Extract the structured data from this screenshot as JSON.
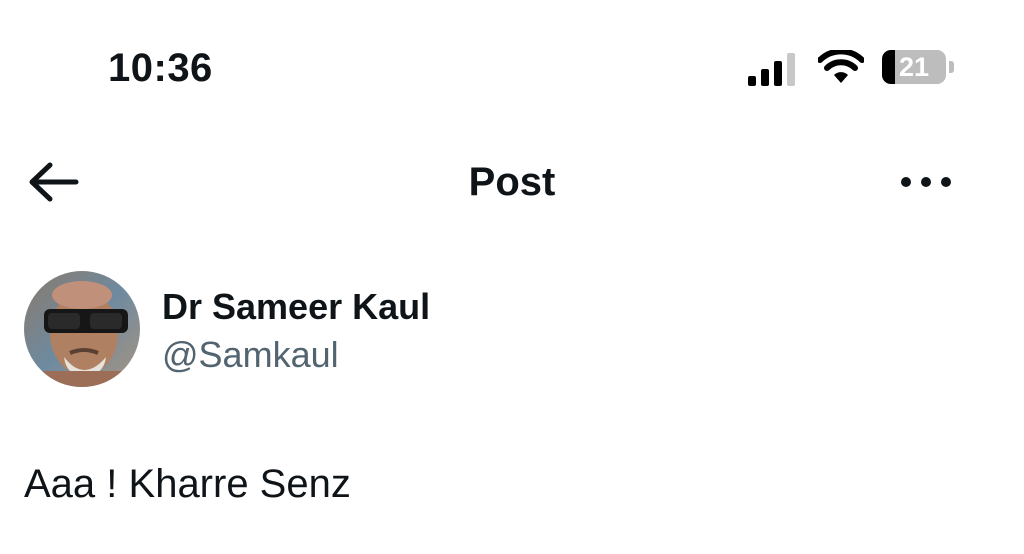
{
  "status_bar": {
    "time": "10:36",
    "battery_level": "21",
    "icons": [
      "cellular-signal-icon",
      "wifi-icon",
      "battery-icon"
    ]
  },
  "nav": {
    "title": "Post",
    "icons": [
      "back-arrow-icon",
      "more-options-icon"
    ]
  },
  "post": {
    "author_name": "Dr Sameer Kaul",
    "author_handle": "@Samkaul",
    "text": "Aaa ! Kharre Senz"
  },
  "colors": {
    "text_primary": "#0f1419",
    "text_secondary": "#536471",
    "background": "#ffffff"
  }
}
